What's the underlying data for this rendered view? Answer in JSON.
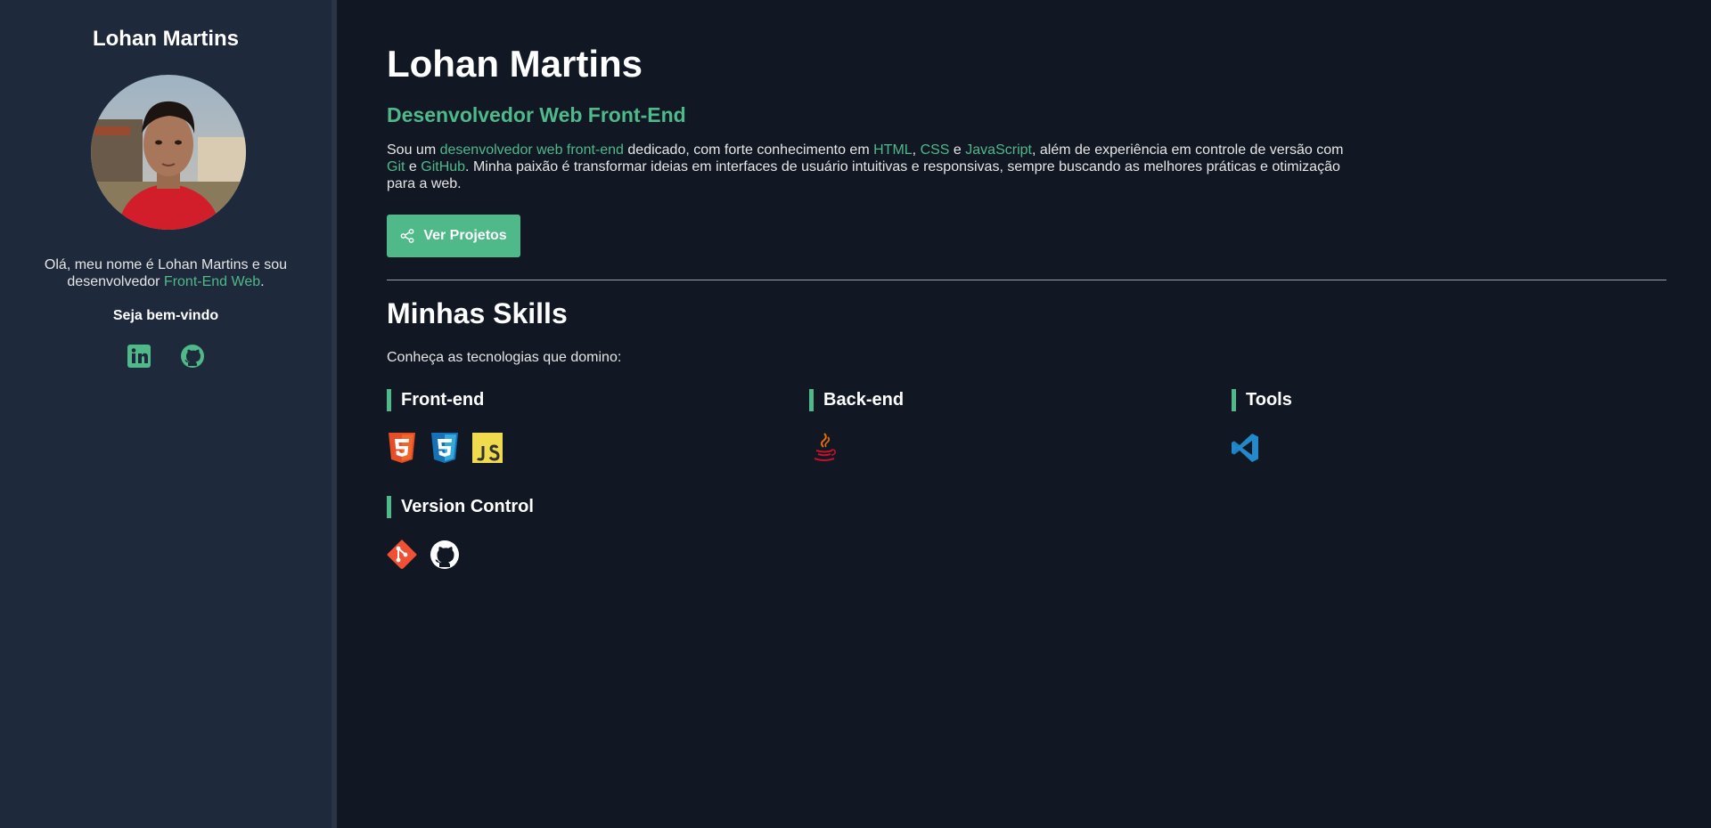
{
  "sidebar": {
    "name": "Lohan Martins",
    "intro_prefix": "Olá, meu nome é Lohan Martins e sou desenvolvedor ",
    "intro_link": "Front-End Web",
    "intro_suffix": ".",
    "welcome": "Seja bem-vindo",
    "social": [
      "linkedin-icon",
      "github-icon"
    ]
  },
  "main": {
    "title": "Lohan Martins",
    "subtitle": "Desenvolvedor Web Front-End",
    "intro": {
      "t1": "Sou um ",
      "l1": "desenvolvedor web front-end",
      "t2": " dedicado, com forte conhecimento em ",
      "l2": "HTML",
      "t3": ", ",
      "l3": "CSS",
      "t4": " e ",
      "l4": "JavaScript",
      "t5": ", além de experiência em controle de versão com ",
      "l5": "Git",
      "t6": " e ",
      "l6": "GitHub",
      "t7": ". Minha paixão é transformar ideias em interfaces de usuário intuitivas e responsivas, sempre buscando as melhores práticas e otimização para a web."
    },
    "button_label": "Ver Projetos"
  },
  "skills": {
    "title": "Minhas Skills",
    "description": "Conheça as tecnologias que domino:",
    "categories": [
      {
        "name": "Front-end",
        "icons": [
          "html5-icon",
          "css3-icon",
          "javascript-icon"
        ]
      },
      {
        "name": "Back-end",
        "icons": [
          "java-icon"
        ]
      },
      {
        "name": "Tools",
        "icons": [
          "vscode-icon"
        ]
      },
      {
        "name": "Version Control",
        "icons": [
          "git-icon",
          "github-icon"
        ]
      }
    ]
  },
  "colors": {
    "accent": "#4fb98a",
    "background": "#111823",
    "sidebar": "#1e293b"
  }
}
